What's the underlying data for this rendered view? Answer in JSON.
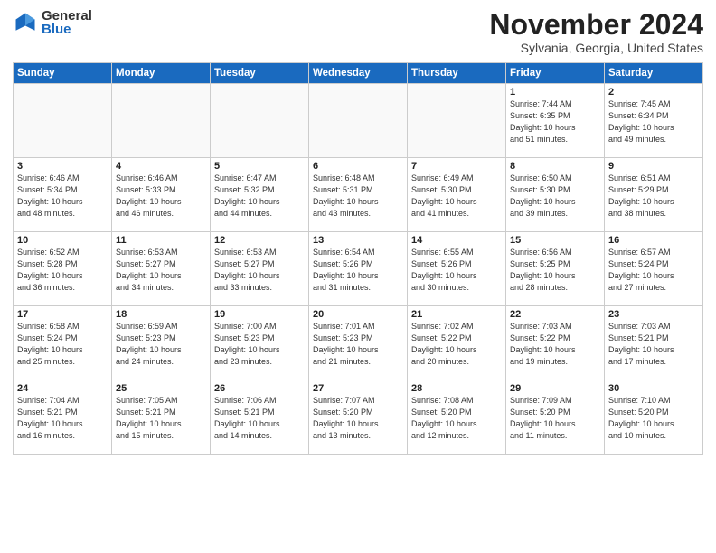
{
  "logo": {
    "general": "General",
    "blue": "Blue"
  },
  "header": {
    "month": "November 2024",
    "location": "Sylvania, Georgia, United States"
  },
  "weekdays": [
    "Sunday",
    "Monday",
    "Tuesday",
    "Wednesday",
    "Thursday",
    "Friday",
    "Saturday"
  ],
  "weeks": [
    [
      {
        "day": "",
        "info": ""
      },
      {
        "day": "",
        "info": ""
      },
      {
        "day": "",
        "info": ""
      },
      {
        "day": "",
        "info": ""
      },
      {
        "day": "",
        "info": ""
      },
      {
        "day": "1",
        "info": "Sunrise: 7:44 AM\nSunset: 6:35 PM\nDaylight: 10 hours\nand 51 minutes."
      },
      {
        "day": "2",
        "info": "Sunrise: 7:45 AM\nSunset: 6:34 PM\nDaylight: 10 hours\nand 49 minutes."
      }
    ],
    [
      {
        "day": "3",
        "info": "Sunrise: 6:46 AM\nSunset: 5:34 PM\nDaylight: 10 hours\nand 48 minutes."
      },
      {
        "day": "4",
        "info": "Sunrise: 6:46 AM\nSunset: 5:33 PM\nDaylight: 10 hours\nand 46 minutes."
      },
      {
        "day": "5",
        "info": "Sunrise: 6:47 AM\nSunset: 5:32 PM\nDaylight: 10 hours\nand 44 minutes."
      },
      {
        "day": "6",
        "info": "Sunrise: 6:48 AM\nSunset: 5:31 PM\nDaylight: 10 hours\nand 43 minutes."
      },
      {
        "day": "7",
        "info": "Sunrise: 6:49 AM\nSunset: 5:30 PM\nDaylight: 10 hours\nand 41 minutes."
      },
      {
        "day": "8",
        "info": "Sunrise: 6:50 AM\nSunset: 5:30 PM\nDaylight: 10 hours\nand 39 minutes."
      },
      {
        "day": "9",
        "info": "Sunrise: 6:51 AM\nSunset: 5:29 PM\nDaylight: 10 hours\nand 38 minutes."
      }
    ],
    [
      {
        "day": "10",
        "info": "Sunrise: 6:52 AM\nSunset: 5:28 PM\nDaylight: 10 hours\nand 36 minutes."
      },
      {
        "day": "11",
        "info": "Sunrise: 6:53 AM\nSunset: 5:27 PM\nDaylight: 10 hours\nand 34 minutes."
      },
      {
        "day": "12",
        "info": "Sunrise: 6:53 AM\nSunset: 5:27 PM\nDaylight: 10 hours\nand 33 minutes."
      },
      {
        "day": "13",
        "info": "Sunrise: 6:54 AM\nSunset: 5:26 PM\nDaylight: 10 hours\nand 31 minutes."
      },
      {
        "day": "14",
        "info": "Sunrise: 6:55 AM\nSunset: 5:26 PM\nDaylight: 10 hours\nand 30 minutes."
      },
      {
        "day": "15",
        "info": "Sunrise: 6:56 AM\nSunset: 5:25 PM\nDaylight: 10 hours\nand 28 minutes."
      },
      {
        "day": "16",
        "info": "Sunrise: 6:57 AM\nSunset: 5:24 PM\nDaylight: 10 hours\nand 27 minutes."
      }
    ],
    [
      {
        "day": "17",
        "info": "Sunrise: 6:58 AM\nSunset: 5:24 PM\nDaylight: 10 hours\nand 25 minutes."
      },
      {
        "day": "18",
        "info": "Sunrise: 6:59 AM\nSunset: 5:23 PM\nDaylight: 10 hours\nand 24 minutes."
      },
      {
        "day": "19",
        "info": "Sunrise: 7:00 AM\nSunset: 5:23 PM\nDaylight: 10 hours\nand 23 minutes."
      },
      {
        "day": "20",
        "info": "Sunrise: 7:01 AM\nSunset: 5:23 PM\nDaylight: 10 hours\nand 21 minutes."
      },
      {
        "day": "21",
        "info": "Sunrise: 7:02 AM\nSunset: 5:22 PM\nDaylight: 10 hours\nand 20 minutes."
      },
      {
        "day": "22",
        "info": "Sunrise: 7:03 AM\nSunset: 5:22 PM\nDaylight: 10 hours\nand 19 minutes."
      },
      {
        "day": "23",
        "info": "Sunrise: 7:03 AM\nSunset: 5:21 PM\nDaylight: 10 hours\nand 17 minutes."
      }
    ],
    [
      {
        "day": "24",
        "info": "Sunrise: 7:04 AM\nSunset: 5:21 PM\nDaylight: 10 hours\nand 16 minutes."
      },
      {
        "day": "25",
        "info": "Sunrise: 7:05 AM\nSunset: 5:21 PM\nDaylight: 10 hours\nand 15 minutes."
      },
      {
        "day": "26",
        "info": "Sunrise: 7:06 AM\nSunset: 5:21 PM\nDaylight: 10 hours\nand 14 minutes."
      },
      {
        "day": "27",
        "info": "Sunrise: 7:07 AM\nSunset: 5:20 PM\nDaylight: 10 hours\nand 13 minutes."
      },
      {
        "day": "28",
        "info": "Sunrise: 7:08 AM\nSunset: 5:20 PM\nDaylight: 10 hours\nand 12 minutes."
      },
      {
        "day": "29",
        "info": "Sunrise: 7:09 AM\nSunset: 5:20 PM\nDaylight: 10 hours\nand 11 minutes."
      },
      {
        "day": "30",
        "info": "Sunrise: 7:10 AM\nSunset: 5:20 PM\nDaylight: 10 hours\nand 10 minutes."
      }
    ]
  ]
}
